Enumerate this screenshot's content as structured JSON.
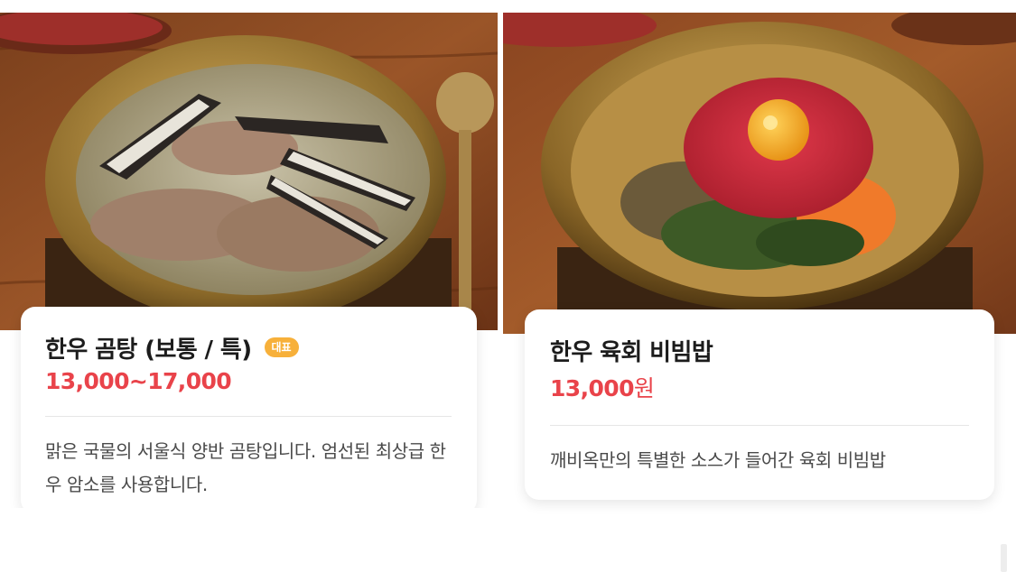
{
  "menu_items": [
    {
      "name": "한우 곰탕 (보통 / 특)",
      "badge": "대표",
      "price": "13,000~17,000",
      "price_unit": "",
      "description": "맑은 국물의 서울식 양반 곰탕입니다. 엄선된 최상급 한우 암소를 사용합니다."
    },
    {
      "name": "한우 육회 비빔밥",
      "badge": "",
      "price": "13,000",
      "price_unit": "원",
      "description": "깨비옥만의 특별한 소스가 들어간 육회 비빔밥"
    }
  ],
  "colors": {
    "price": "#e9434a",
    "badge": "#f7b03a",
    "title": "#1c1c1c",
    "description": "#4a4a4a"
  }
}
